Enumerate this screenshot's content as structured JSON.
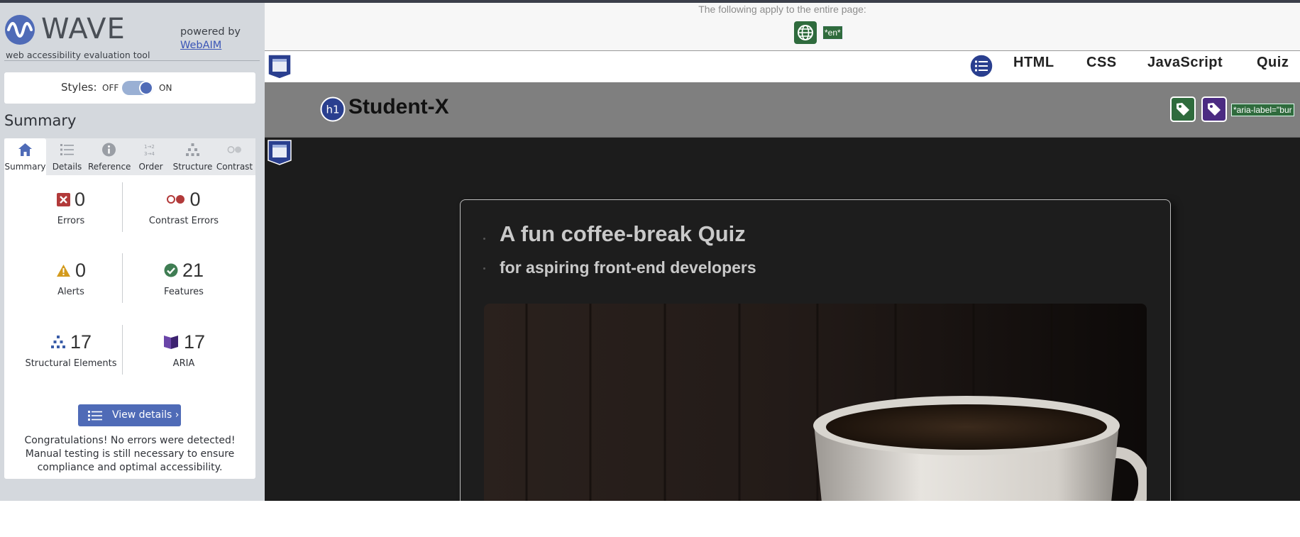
{
  "sidebar": {
    "brand": {
      "name": "WAVE",
      "tagline": "web accessibility evaluation tool",
      "powered_by": "powered by",
      "webaim_link": "WebAIM"
    },
    "styles": {
      "label": "Styles:",
      "off": "OFF",
      "on": "ON",
      "state": "on"
    },
    "summary_heading": "Summary",
    "tabs": [
      {
        "label": "Summary",
        "icon": "home-icon",
        "active": true
      },
      {
        "label": "Details",
        "icon": "list-icon"
      },
      {
        "label": "Reference",
        "icon": "info-icon"
      },
      {
        "label": "Order",
        "icon": "order-icon"
      },
      {
        "label": "Structure",
        "icon": "structure-icon"
      },
      {
        "label": "Contrast",
        "icon": "contrast-icon"
      }
    ],
    "stats": {
      "errors": {
        "count": "0",
        "label": "Errors",
        "color": "#b23a3a"
      },
      "contrast_errors": {
        "count": "0",
        "label": "Contrast Errors",
        "color": "#b23a3a"
      },
      "alerts": {
        "count": "0",
        "label": "Alerts",
        "color": "#d39a1c"
      },
      "features": {
        "count": "21",
        "label": "Features",
        "color": "#3f7d53"
      },
      "structural": {
        "count": "17",
        "label": "Structural Elements",
        "color": "#3a5da8"
      },
      "aria": {
        "count": "17",
        "label": "ARIA",
        "color": "#4b2b82"
      }
    },
    "view_details": "View details ›",
    "congrats": "Congratulations! No errors were detected! Manual testing is still necessary to ensure compliance and optimal accessibility."
  },
  "page": {
    "doc_note": "The following apply to the entire page:",
    "lang_tag": "*en*",
    "nav": [
      "HTML",
      "CSS",
      "JavaScript",
      "Quiz"
    ],
    "h1_badge": "h1",
    "site_title": "Student-X",
    "aria_tag": "*aria-label=\"bur",
    "quiz_title": "A fun coffee-break Quiz",
    "quiz_subtitle": "for aspiring front-end developers",
    "colors": {
      "accent": "#4f6bb7",
      "page_bg": "#1c1c1c",
      "header_band": "#7f7f7f"
    }
  }
}
